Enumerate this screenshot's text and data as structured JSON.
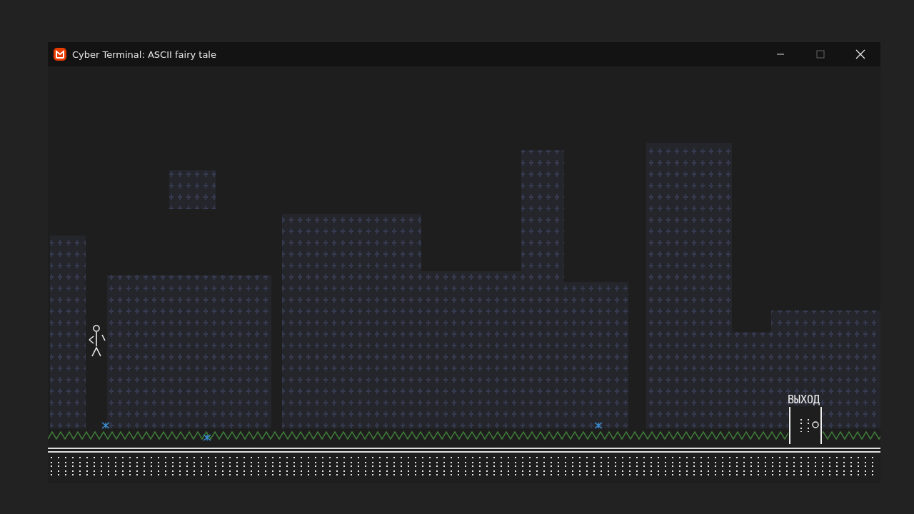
{
  "window": {
    "title": "Cyber Terminal: ASCII fairy tale"
  },
  "game": {
    "exit_sign": "ВЫХОД"
  }
}
